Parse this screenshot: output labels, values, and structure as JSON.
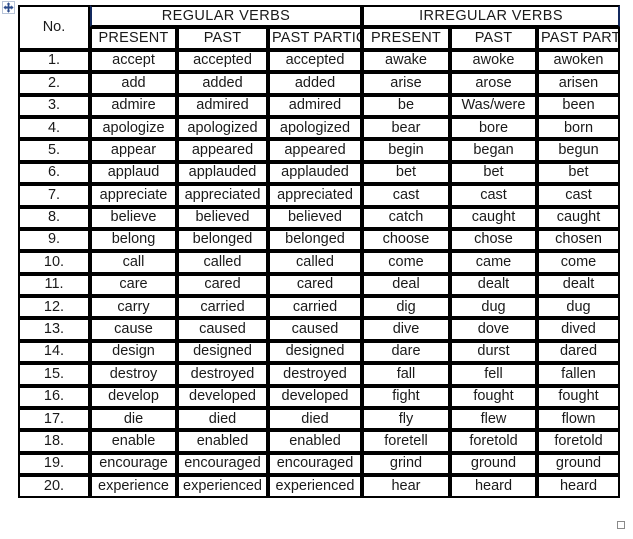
{
  "table": {
    "no_header": "No.",
    "groups": [
      {
        "label": "REGULAR VERBS"
      },
      {
        "label": "IRREGULAR VERBS"
      }
    ],
    "subheaders": [
      "PRESENT",
      "PAST",
      "PAST PARTICIPLE",
      "PRESENT",
      "PAST",
      "PAST PARTICIPLE"
    ],
    "rows": [
      {
        "no": "1.",
        "reg_present": "accept",
        "reg_past": "accepted",
        "reg_pp": "accepted",
        "irr_present": "awake",
        "irr_past": "awoke",
        "irr_pp": "awoken"
      },
      {
        "no": "2.",
        "reg_present": "add",
        "reg_past": "added",
        "reg_pp": "added",
        "irr_present": "arise",
        "irr_past": "arose",
        "irr_pp": "arisen"
      },
      {
        "no": "3.",
        "reg_present": "admire",
        "reg_past": "admired",
        "reg_pp": "admired",
        "irr_present": "be",
        "irr_past": "Was/were",
        "irr_pp": "been"
      },
      {
        "no": "4.",
        "reg_present": "apologize",
        "reg_past": "apologized",
        "reg_pp": "apologized",
        "irr_present": "bear",
        "irr_past": "bore",
        "irr_pp": "born"
      },
      {
        "no": "5.",
        "reg_present": "appear",
        "reg_past": "appeared",
        "reg_pp": "appeared",
        "irr_present": "begin",
        "irr_past": "began",
        "irr_pp": "begun"
      },
      {
        "no": "6.",
        "reg_present": "applaud",
        "reg_past": "applauded",
        "reg_pp": "applauded",
        "irr_present": "bet",
        "irr_past": "bet",
        "irr_pp": "bet"
      },
      {
        "no": "7.",
        "reg_present": "appreciate",
        "reg_past": "appreciated",
        "reg_pp": "appreciated",
        "irr_present": "cast",
        "irr_past": "cast",
        "irr_pp": "cast"
      },
      {
        "no": "8.",
        "reg_present": "believe",
        "reg_past": "believed",
        "reg_pp": "believed",
        "irr_present": "catch",
        "irr_past": "caught",
        "irr_pp": "caught"
      },
      {
        "no": "9.",
        "reg_present": "belong",
        "reg_past": "belonged",
        "reg_pp": "belonged",
        "irr_present": "choose",
        "irr_past": "chose",
        "irr_pp": "chosen"
      },
      {
        "no": "10.",
        "reg_present": "call",
        "reg_past": "called",
        "reg_pp": "called",
        "irr_present": "come",
        "irr_past": "came",
        "irr_pp": "come"
      },
      {
        "no": "11.",
        "reg_present": "care",
        "reg_past": "cared",
        "reg_pp": "cared",
        "irr_present": "deal",
        "irr_past": "dealt",
        "irr_pp": "dealt"
      },
      {
        "no": "12.",
        "reg_present": "carry",
        "reg_past": "carried",
        "reg_pp": "carried",
        "irr_present": "dig",
        "irr_past": "dug",
        "irr_pp": "dug"
      },
      {
        "no": "13.",
        "reg_present": "cause",
        "reg_past": "caused",
        "reg_pp": "caused",
        "irr_present": "dive",
        "irr_past": "dove",
        "irr_pp": "dived"
      },
      {
        "no": "14.",
        "reg_present": "design",
        "reg_past": "designed",
        "reg_pp": "designed",
        "irr_present": "dare",
        "irr_past": "durst",
        "irr_pp": "dared"
      },
      {
        "no": "15.",
        "reg_present": "destroy",
        "reg_past": "destroyed",
        "reg_pp": "destroyed",
        "irr_present": "fall",
        "irr_past": "fell",
        "irr_pp": "fallen"
      },
      {
        "no": "16.",
        "reg_present": "develop",
        "reg_past": "developed",
        "reg_pp": "developed",
        "irr_present": "fight",
        "irr_past": "fought",
        "irr_pp": "fought"
      },
      {
        "no": "17.",
        "reg_present": "die",
        "reg_past": "died",
        "reg_pp": "died",
        "irr_present": "fly",
        "irr_past": "flew",
        "irr_pp": "flown"
      },
      {
        "no": "18.",
        "reg_present": "enable",
        "reg_past": "enabled",
        "reg_pp": "enabled",
        "irr_present": "foretell",
        "irr_past": "foretold",
        "irr_pp": "foretold"
      },
      {
        "no": "19.",
        "reg_present": "encourage",
        "reg_past": "encouraged",
        "reg_pp": "encouraged",
        "irr_present": "grind",
        "irr_past": "ground",
        "irr_pp": "ground"
      },
      {
        "no": "20.",
        "reg_present": "experience",
        "reg_past": "experienced",
        "reg_pp": "experienced",
        "irr_present": "hear",
        "irr_past": "heard",
        "irr_pp": "heard"
      }
    ]
  },
  "colors": {
    "header_navy": "#13295E",
    "border": "#000000",
    "text": "#1a1a1a",
    "header_text": "#ffffff"
  },
  "handles": {
    "move_handle": "table-move-handle-icon",
    "resize_handle": "table-resize-handle-icon"
  }
}
